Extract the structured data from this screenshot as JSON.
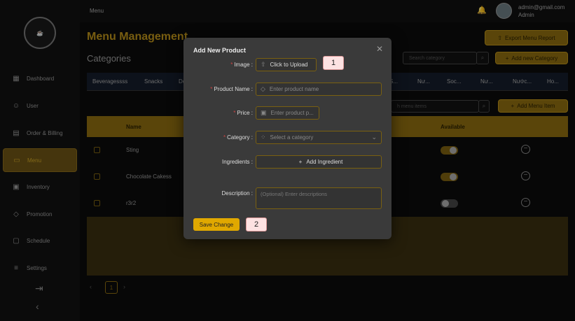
{
  "topbar": {
    "title": "Menu",
    "email": "admin@gmail.com",
    "role": "Admin"
  },
  "sidebar": {
    "items": [
      {
        "label": "Dashboard",
        "icon": "grid-icon"
      },
      {
        "label": "User",
        "icon": "users-icon"
      },
      {
        "label": "Order & Billing",
        "icon": "receipt-icon"
      },
      {
        "label": "Menu",
        "icon": "book-icon",
        "active": true
      },
      {
        "label": "Inventory",
        "icon": "inventory-icon"
      },
      {
        "label": "Promotion",
        "icon": "tag-icon"
      },
      {
        "label": "Schedule",
        "icon": "calendar-icon"
      },
      {
        "label": "Settings",
        "icon": "sliders-icon"
      }
    ]
  },
  "main": {
    "title": "Menu Management",
    "categories_title": "Categories",
    "export_label": "Export Menu Report",
    "category_search_placeholder": "Search category",
    "add_category_label": "Add new Category",
    "tabs": [
      "Beveragessss",
      "Snacks",
      "De",
      "S...",
      "Nư...",
      "Soc...",
      "Nư...",
      "Nước...",
      "Ho..."
    ],
    "item_search_placeholder": "h menu items",
    "add_item_label": "Add Menu Item",
    "columns": {
      "name": "Name",
      "available": "Available"
    },
    "rows": [
      {
        "name": "Sting",
        "available": true
      },
      {
        "name": "Chocolate Cakess",
        "available": true
      },
      {
        "name": "r3r2",
        "available": false
      }
    ],
    "page": "1"
  },
  "modal": {
    "title": "Add New Product",
    "image_label": "Image :",
    "upload_label": "Click to Upload",
    "product_name_label": "Product Name :",
    "product_name_placeholder": "Enter product name",
    "price_label": "Price :",
    "price_placeholder": "Enter product p...",
    "category_label": "Category :",
    "category_placeholder": "Select a category",
    "ingredients_label": "Ingredients :",
    "add_ingredient_label": "Add Ingredient",
    "description_label": "Description :",
    "description_placeholder": "(Optional) Enter descriptions",
    "save_label": "Save Change"
  },
  "markers": [
    "1",
    "2"
  ],
  "colors": {
    "accent": "#e0a800",
    "dark": "#000000",
    "modal": "#3a3a3a"
  }
}
